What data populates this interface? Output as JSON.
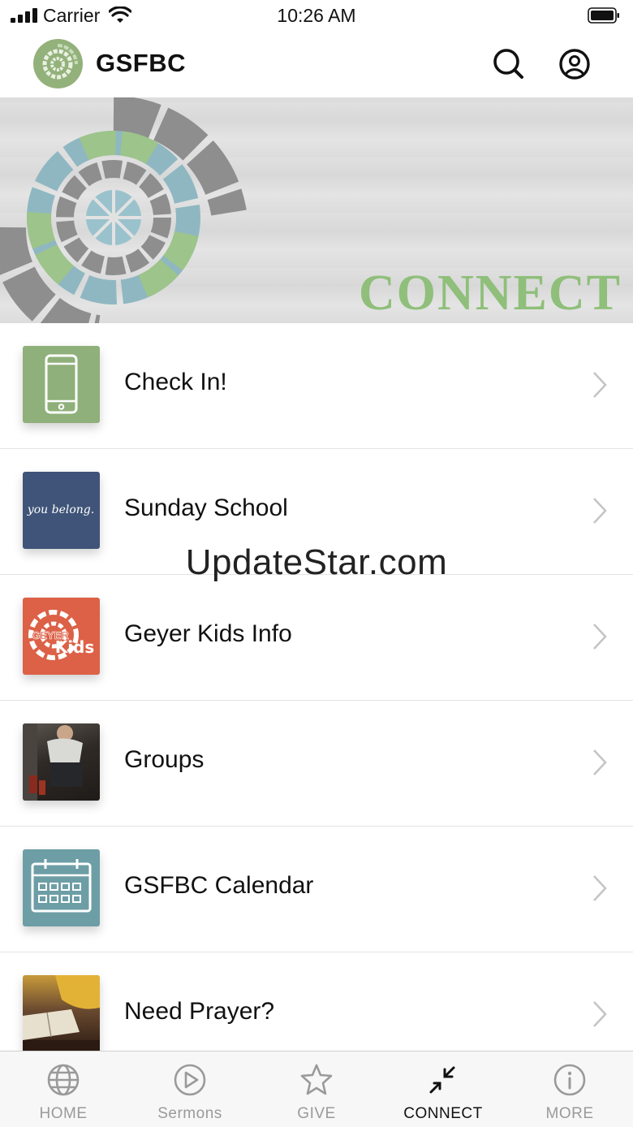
{
  "status_bar": {
    "carrier": "Carrier",
    "time": "10:26 AM"
  },
  "header": {
    "title": "GSFBC",
    "search_icon": "search-icon",
    "account_icon": "user-circle-icon"
  },
  "banner": {
    "title": "CONNECT"
  },
  "menu": {
    "items": [
      {
        "label": "Check In!",
        "thumb": "phone-icon",
        "color": "#8fb07a"
      },
      {
        "label": "Sunday School",
        "thumb": "you belong.",
        "color": "#3f5478"
      },
      {
        "label": "Geyer Kids Info",
        "thumb": "GEYER Kids",
        "color": "#dc6147"
      },
      {
        "label": "Groups",
        "thumb": "photo",
        "color": "#3c3530"
      },
      {
        "label": "GSFBC Calendar",
        "thumb": "calendar-icon",
        "color": "#6d9ea6"
      },
      {
        "label": "Need Prayer?",
        "thumb": "photo",
        "color": "#5a3d2a"
      }
    ]
  },
  "watermark": "UpdateStar.com",
  "tab_bar": {
    "tabs": [
      {
        "label": "HOME",
        "icon": "globe-icon"
      },
      {
        "label": "Sermons",
        "icon": "play-circle-icon"
      },
      {
        "label": "GIVE",
        "icon": "star-icon"
      },
      {
        "label": "CONNECT",
        "icon": "connect-arrows-icon",
        "active": true
      },
      {
        "label": "MORE",
        "icon": "info-icon"
      }
    ]
  },
  "colors": {
    "brand_green": "#8fbf7a",
    "tab_inactive": "#9a9a9a",
    "tab_active": "#111111"
  }
}
